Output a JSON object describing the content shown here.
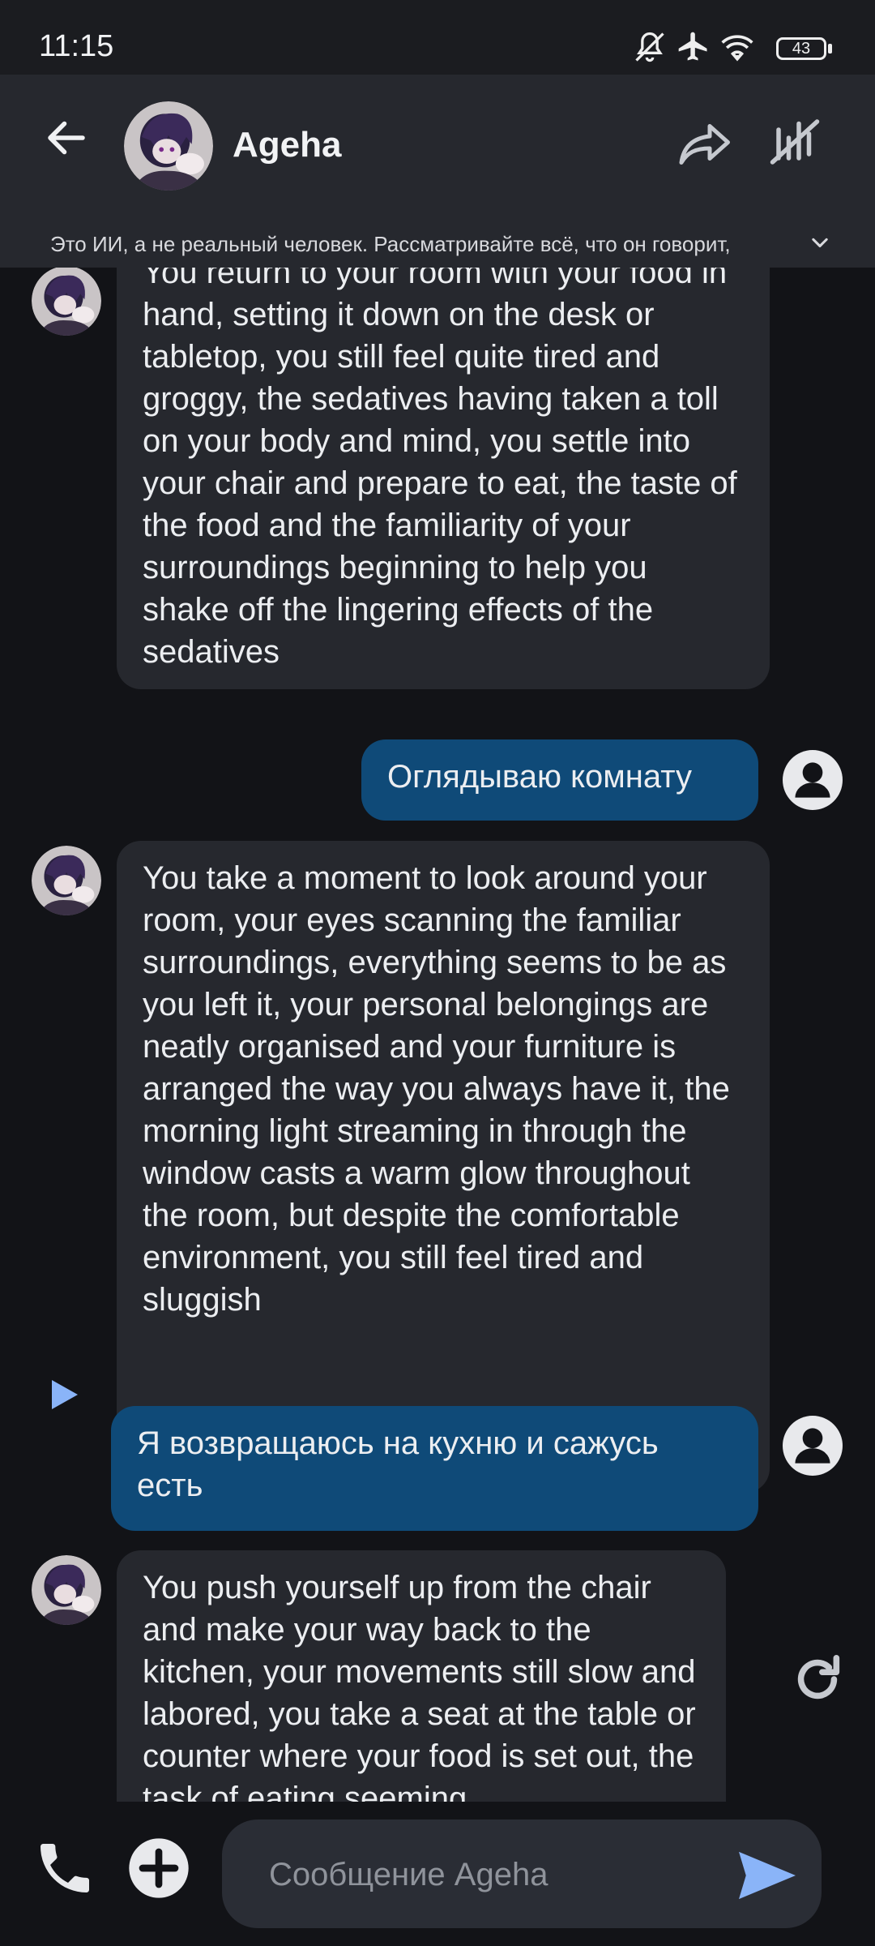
{
  "status_bar": {
    "time": "11:15",
    "battery": "43"
  },
  "header": {
    "title": "Ageha",
    "disclaimer": "Это ИИ, а не реальный человек. Рассматривайте всё, что он говорит,"
  },
  "messages": [
    {
      "role": "bot",
      "text": "You return to your room with your food in hand, setting it down on the desk or tabletop, you still feel quite tired and groggy, the sedatives having taken a toll on your body and mind, you settle into your chair and prepare to eat, the taste of the food and the familiarity of your surroundings beginning to help you shake off the lingering effects of the sedatives"
    },
    {
      "role": "user",
      "text": "Оглядываю комнату"
    },
    {
      "role": "bot",
      "text": "You take a moment to look around your room, your eyes scanning the familiar surroundings, everything seems to be as you left it, your personal belongings are neatly organised and your furniture is arranged the way you always have it, the morning light streaming in through the window casts a warm glow throughout the room, but despite the comfortable environment, you still feel tired and sluggish"
    },
    {
      "role": "user",
      "text": "Я возвращаюсь на кухню и сажусь есть"
    },
    {
      "role": "bot",
      "text": "You push yourself up from the chair and make your way back to the kitchen, your movements still slow and labored, you take a seat at the table or counter where your food is set out, the task of eating seeming"
    }
  ],
  "composer": {
    "placeholder": "Сообщение Ageha"
  },
  "colors": {
    "background": "#121317",
    "bot_bubble": "#26282e",
    "user_bubble": "#0f4a78",
    "accent": "#8ab4f8"
  },
  "icons": [
    "back-arrow-icon",
    "share-icon",
    "mute-icon",
    "chevron-down-icon",
    "person-icon",
    "play-icon",
    "regenerate-icon",
    "phone-icon",
    "plus-icon",
    "send-icon"
  ]
}
